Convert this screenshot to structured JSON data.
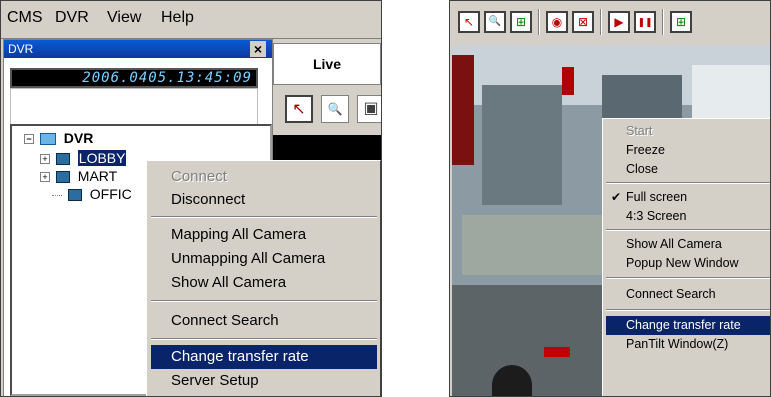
{
  "left": {
    "menubar": {
      "items": [
        {
          "label": "CMS"
        },
        {
          "label": "DVR"
        },
        {
          "label": "View"
        },
        {
          "label": "Help"
        }
      ]
    },
    "panel": {
      "title": "DVR",
      "close_glyph": "×",
      "clock": "2006.0405.13:45:09"
    },
    "tree": {
      "root": {
        "label": "DVR",
        "toggle": "−"
      },
      "children": [
        {
          "label": "LOBBY",
          "toggle": "+",
          "selected": true
        },
        {
          "label": "MART",
          "toggle": "+"
        },
        {
          "label": "OFFIC",
          "toggle": ""
        }
      ]
    },
    "live": {
      "tab_label": "Live",
      "tools": [
        {
          "icon": "pointer-icon",
          "glyph": "↖"
        },
        {
          "icon": "zoom-icon",
          "glyph": "🔍"
        },
        {
          "icon": "monitor-icon",
          "glyph": "▣"
        }
      ]
    },
    "context_menu": {
      "items": [
        {
          "label": "Connect",
          "state": "disabled"
        },
        {
          "label": "Disconnect",
          "state": "normal"
        },
        {
          "label": "Mapping All Camera",
          "state": "normal"
        },
        {
          "label": "Unmapping All Camera",
          "state": "normal"
        },
        {
          "label": "Show All Camera",
          "state": "normal"
        },
        {
          "label": "Connect Search",
          "state": "normal"
        },
        {
          "label": "Change transfer rate",
          "state": "selected"
        },
        {
          "label": "Server Setup",
          "state": "normal"
        }
      ]
    }
  },
  "right": {
    "toolbar": {
      "buttons": [
        {
          "icon": "pointer-icon",
          "glyph": "↖"
        },
        {
          "icon": "zoom-icon",
          "glyph": "🔍"
        },
        {
          "icon": "add-camera-icon",
          "glyph": "⊞"
        },
        {
          "icon": "record-icon",
          "glyph": "◉"
        },
        {
          "icon": "stop-record-icon",
          "glyph": "⊠"
        },
        {
          "icon": "play-icon",
          "glyph": "▶"
        },
        {
          "icon": "pause-icon",
          "glyph": "❚❚"
        },
        {
          "icon": "layout-icon",
          "glyph": "⊞"
        }
      ]
    },
    "context_menu": {
      "items": [
        {
          "label": "Start",
          "state": "disabled",
          "checked": false
        },
        {
          "label": "Freeze",
          "state": "normal",
          "checked": false
        },
        {
          "label": "Close",
          "state": "normal",
          "checked": false
        },
        {
          "label": "Full screen",
          "state": "normal",
          "checked": true
        },
        {
          "label": "4:3 Screen",
          "state": "normal",
          "checked": false
        },
        {
          "label": "Show All Camera",
          "state": "normal",
          "checked": false
        },
        {
          "label": "Popup New Window",
          "state": "normal",
          "checked": false
        },
        {
          "label": "Connect Search",
          "state": "normal",
          "checked": false
        },
        {
          "label": "Change transfer rate",
          "state": "selected",
          "checked": false
        },
        {
          "label": "PanTilt Window(Z)",
          "state": "normal",
          "checked": false
        }
      ],
      "check_glyph": "✔"
    }
  },
  "colors": {
    "menu_bg": "#d4d0c8",
    "selection": "#0a246a",
    "title_bar": "#0a5ad6",
    "clock_text": "#7fd0ff"
  }
}
